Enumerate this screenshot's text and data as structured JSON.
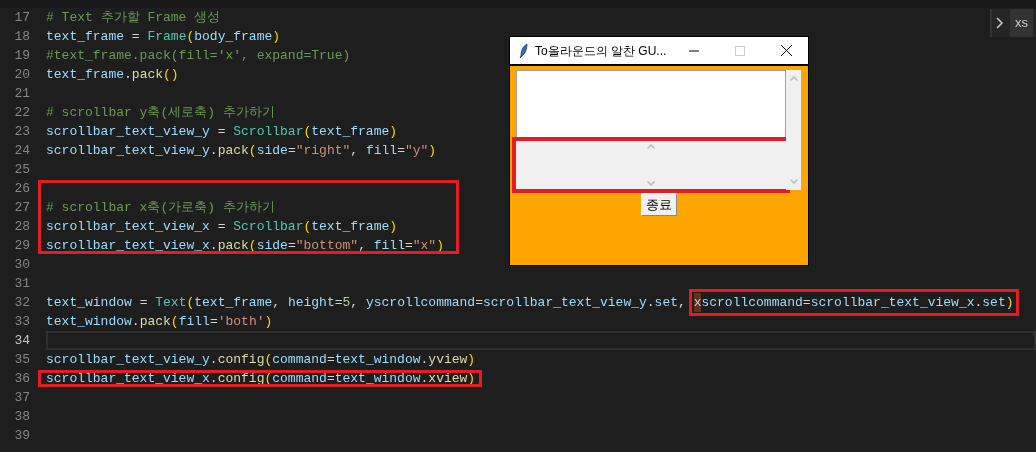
{
  "editor": {
    "lines": [
      {
        "number": "17",
        "tokens": [
          {
            "t": "# Text 추가할 Frame 생성",
            "kind": "comment"
          }
        ]
      },
      {
        "number": "18",
        "tokens": [
          {
            "t": "text_frame",
            "kind": "var"
          },
          {
            "t": " = ",
            "kind": "plain"
          },
          {
            "t": "Frame",
            "kind": "class"
          },
          {
            "t": "(",
            "kind": "bracket"
          },
          {
            "t": "body_frame",
            "kind": "var"
          },
          {
            "t": ")",
            "kind": "bracket"
          }
        ]
      },
      {
        "number": "19",
        "tokens": [
          {
            "t": "#text_frame.pack(fill='x', expand=True)",
            "kind": "comment"
          }
        ]
      },
      {
        "number": "20",
        "tokens": [
          {
            "t": "text_frame",
            "kind": "var"
          },
          {
            "t": ".",
            "kind": "plain"
          },
          {
            "t": "pack",
            "kind": "func"
          },
          {
            "t": "()",
            "kind": "bracket"
          }
        ]
      },
      {
        "number": "21"
      },
      {
        "number": "22",
        "tokens": [
          {
            "t": "# scrollbar y축(세로축) 추가하기",
            "kind": "comment"
          }
        ]
      },
      {
        "number": "23",
        "tokens": [
          {
            "t": "scrollbar_text_view_y",
            "kind": "var"
          },
          {
            "t": " = ",
            "kind": "plain"
          },
          {
            "t": "Scrollbar",
            "kind": "class"
          },
          {
            "t": "(",
            "kind": "bracket"
          },
          {
            "t": "text_frame",
            "kind": "var"
          },
          {
            "t": ")",
            "kind": "bracket"
          }
        ]
      },
      {
        "number": "24",
        "tokens": [
          {
            "t": "scrollbar_text_view_y",
            "kind": "var"
          },
          {
            "t": ".",
            "kind": "plain"
          },
          {
            "t": "pack",
            "kind": "func"
          },
          {
            "t": "(",
            "kind": "bracket"
          },
          {
            "t": "side",
            "kind": "var"
          },
          {
            "t": "=",
            "kind": "plain"
          },
          {
            "t": "\"right\"",
            "kind": "string"
          },
          {
            "t": ", ",
            "kind": "plain"
          },
          {
            "t": "fill",
            "kind": "var"
          },
          {
            "t": "=",
            "kind": "plain"
          },
          {
            "t": "\"y\"",
            "kind": "string"
          },
          {
            "t": ")",
            "kind": "bracket"
          }
        ]
      },
      {
        "number": "25"
      },
      {
        "number": "26",
        "boxed": true
      },
      {
        "number": "27",
        "boxed": true,
        "tokens": [
          {
            "t": "# scrollbar x축(가로축) 추가하기",
            "kind": "comment"
          }
        ]
      },
      {
        "number": "28",
        "boxed": true,
        "tokens": [
          {
            "t": "scrollbar_text_view_x",
            "kind": "var"
          },
          {
            "t": " = ",
            "kind": "plain"
          },
          {
            "t": "Scrollbar",
            "kind": "class"
          },
          {
            "t": "(",
            "kind": "bracket"
          },
          {
            "t": "text_frame",
            "kind": "var"
          },
          {
            "t": ")",
            "kind": "bracket"
          }
        ]
      },
      {
        "number": "29",
        "boxed": true,
        "tokens": [
          {
            "t": "scrollbar_text_view_x",
            "kind": "var"
          },
          {
            "t": ".",
            "kind": "plain"
          },
          {
            "t": "pack",
            "kind": "func"
          },
          {
            "t": "(",
            "kind": "bracket"
          },
          {
            "t": "side",
            "kind": "var"
          },
          {
            "t": "=",
            "kind": "plain"
          },
          {
            "t": "\"bottom\"",
            "kind": "string"
          },
          {
            "t": ", ",
            "kind": "plain"
          },
          {
            "t": "fill",
            "kind": "var"
          },
          {
            "t": "=",
            "kind": "plain"
          },
          {
            "t": "\"x\"",
            "kind": "string"
          },
          {
            "t": ")",
            "kind": "bracket"
          }
        ]
      },
      {
        "number": "30"
      },
      {
        "number": "31"
      },
      {
        "number": "32",
        "tokens": [
          {
            "t": "text_window",
            "kind": "var"
          },
          {
            "t": " = ",
            "kind": "plain"
          },
          {
            "t": "Text",
            "kind": "class"
          },
          {
            "t": "(",
            "kind": "bracket"
          },
          {
            "t": "text_frame",
            "kind": "var"
          },
          {
            "t": ", ",
            "kind": "plain"
          },
          {
            "t": "height",
            "kind": "var"
          },
          {
            "t": "=",
            "kind": "plain"
          },
          {
            "t": "5",
            "kind": "number"
          },
          {
            "t": ", ",
            "kind": "plain"
          },
          {
            "t": "yscrollcommand",
            "kind": "var"
          },
          {
            "t": "=",
            "kind": "plain"
          },
          {
            "t": "scrollbar_text_view_y",
            "kind": "var"
          },
          {
            "t": ".",
            "kind": "plain"
          },
          {
            "t": "set",
            "kind": "var"
          },
          {
            "t": ", ",
            "kind": "plain"
          }
        ],
        "boxed_tokens": [
          {
            "t": "x",
            "kind": "var",
            "highlighted": true
          },
          {
            "t": "scrollcommand",
            "kind": "var"
          },
          {
            "t": "=",
            "kind": "plain"
          },
          {
            "t": "scrollbar_text_view_x",
            "kind": "var"
          },
          {
            "t": ".",
            "kind": "plain"
          },
          {
            "t": "set",
            "kind": "var"
          },
          {
            "t": ")",
            "kind": "bracket"
          }
        ]
      },
      {
        "number": "33",
        "tokens": [
          {
            "t": "text_window",
            "kind": "var"
          },
          {
            "t": ".",
            "kind": "plain"
          },
          {
            "t": "pack",
            "kind": "func"
          },
          {
            "t": "(",
            "kind": "bracket"
          },
          {
            "t": "fill",
            "kind": "var"
          },
          {
            "t": "=",
            "kind": "plain"
          },
          {
            "t": "'both'",
            "kind": "string"
          },
          {
            "t": ")",
            "kind": "bracket"
          }
        ]
      },
      {
        "number": "34",
        "current": true
      },
      {
        "number": "35",
        "tokens": [
          {
            "t": "scrollbar_text_view_y",
            "kind": "var"
          },
          {
            "t": ".",
            "kind": "plain"
          },
          {
            "t": "config",
            "kind": "func"
          },
          {
            "t": "(",
            "kind": "bracket"
          },
          {
            "t": "command",
            "kind": "var"
          },
          {
            "t": "=",
            "kind": "plain"
          },
          {
            "t": "text_window",
            "kind": "var"
          },
          {
            "t": ".",
            "kind": "plain"
          },
          {
            "t": "yview",
            "kind": "func"
          },
          {
            "t": ")",
            "kind": "bracket"
          }
        ]
      },
      {
        "number": "36",
        "boxed": true,
        "tokens": [
          {
            "t": "scrollbar_text_view_x",
            "kind": "var"
          },
          {
            "t": ".",
            "kind": "plain"
          },
          {
            "t": "config",
            "kind": "func"
          },
          {
            "t": "(",
            "kind": "bracket"
          },
          {
            "t": "command",
            "kind": "var"
          },
          {
            "t": "=",
            "kind": "plain"
          },
          {
            "t": "text_window",
            "kind": "var"
          },
          {
            "t": ".",
            "kind": "plain"
          },
          {
            "t": "xview",
            "kind": "func"
          },
          {
            "t": ")",
            "kind": "bracket"
          }
        ]
      },
      {
        "number": "37"
      },
      {
        "number": "38"
      },
      {
        "number": "39"
      }
    ]
  },
  "side_panel": {
    "label": "xs"
  },
  "tk_window": {
    "title": "To올라운드의 알찬 GU...",
    "horizontal_scrollbar_boxed": true,
    "button": "종료"
  }
}
